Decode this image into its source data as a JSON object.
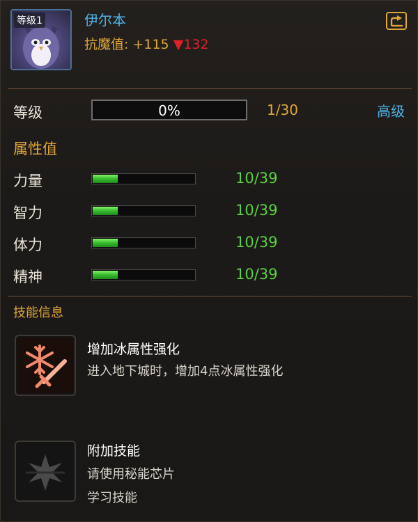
{
  "character": {
    "level_badge": "等级1",
    "name": "伊尔本",
    "resist_label": "抗魔值:",
    "resist_up": "+115",
    "resist_down_arrow": "▼",
    "resist_down": "132"
  },
  "level": {
    "label": "等级",
    "percent_text": "0%",
    "progress": 0,
    "count": "1/30",
    "advanced_label": "高级"
  },
  "attributes": {
    "title": "属性值",
    "items": [
      {
        "label": "力量",
        "value": "10/39",
        "fraction": 0.256
      },
      {
        "label": "智力",
        "value": "10/39",
        "fraction": 0.256
      },
      {
        "label": "体力",
        "value": "10/39",
        "fraction": 0.256
      },
      {
        "label": "精神",
        "value": "10/39",
        "fraction": 0.256
      }
    ]
  },
  "skills": {
    "title": "技能信息",
    "items": [
      {
        "name": "增加冰属性强化",
        "desc_lines": [
          "进入地下城时，增加4点冰属性强化"
        ],
        "icon": "ice-sword-icon"
      },
      {
        "name": "附加技能",
        "desc_lines": [
          "请使用秘能芯片",
          "学习技能"
        ],
        "icon": "chip-skill-icon"
      }
    ]
  },
  "colors": {
    "gold": "#e0a638",
    "blue": "#4fb3e8",
    "green": "#59d23c",
    "red": "#e0202a"
  }
}
